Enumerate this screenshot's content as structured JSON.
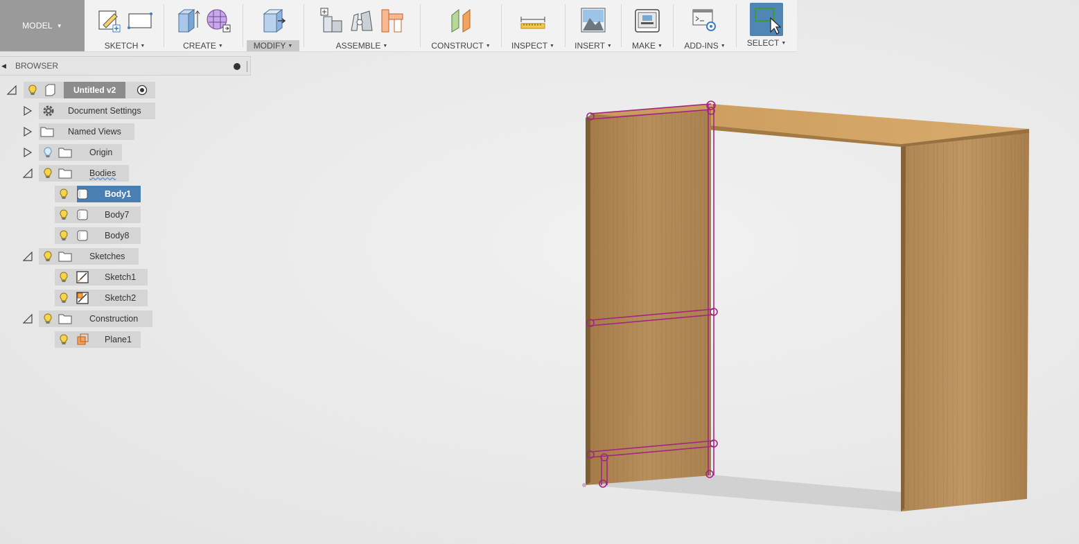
{
  "toolbar": {
    "model_label": "MODEL",
    "groups": [
      {
        "label": "SKETCH",
        "icons": [
          "create-sketch-icon",
          "rectangle-icon"
        ]
      },
      {
        "label": "CREATE",
        "icons": [
          "extrude-icon",
          "form-icon"
        ]
      },
      {
        "label": "MODIFY",
        "icons": [
          "press-pull-icon"
        ]
      },
      {
        "label": "ASSEMBLE",
        "icons": [
          "new-component-icon",
          "joint-icon",
          "as-built-joint-icon"
        ]
      },
      {
        "label": "CONSTRUCT",
        "icons": [
          "offset-plane-icon"
        ]
      },
      {
        "label": "INSPECT",
        "icons": [
          "measure-icon"
        ]
      },
      {
        "label": "INSERT",
        "icons": [
          "insert-image-icon"
        ]
      },
      {
        "label": "MAKE",
        "icons": [
          "3d-print-icon"
        ]
      },
      {
        "label": "ADD-INS",
        "icons": [
          "scripts-addins-icon"
        ]
      },
      {
        "label": "SELECT",
        "icons": [
          "select-cursor-icon"
        ]
      }
    ]
  },
  "browser": {
    "title": "BROWSER",
    "root": "Untitled v2",
    "items": [
      {
        "label": "Document Settings"
      },
      {
        "label": "Named Views"
      },
      {
        "label": "Origin"
      },
      {
        "label": "Bodies"
      },
      {
        "label": "Body1"
      },
      {
        "label": "Body7"
      },
      {
        "label": "Body8"
      },
      {
        "label": "Sketches"
      },
      {
        "label": "Sketch1"
      },
      {
        "label": "Sketch2"
      },
      {
        "label": "Construction"
      },
      {
        "label": "Plane1"
      }
    ]
  },
  "colors": {
    "accent": "#4a7fb3",
    "sketch_line": "#a3257f",
    "wood": "#b48a55"
  }
}
